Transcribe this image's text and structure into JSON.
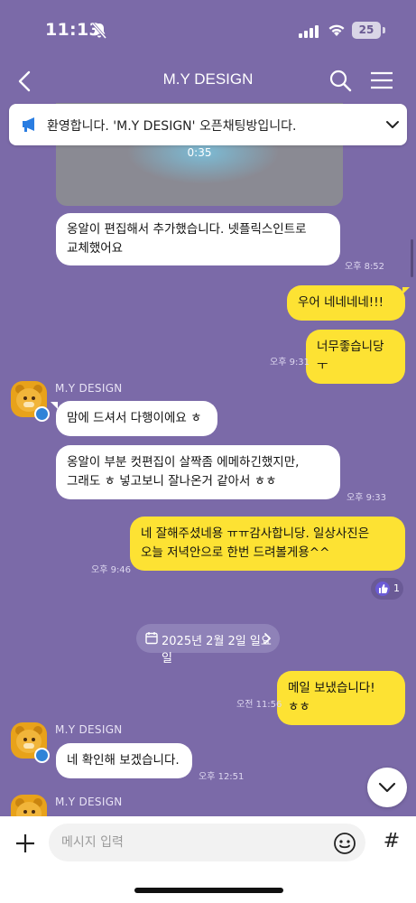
{
  "status_bar": {
    "time": "11:13",
    "battery": "25"
  },
  "header": {
    "title": "M.Y DESIGN"
  },
  "notice": {
    "text": "환영합니다. 'M.Y DESIGN' 오픈채팅방입니다."
  },
  "video": {
    "duration": "0:35"
  },
  "messages": [
    {
      "text": "옹알이 편집해서 추가했습니다. 넷플릭스인트로 교체했어요",
      "time": "오후 8:52"
    },
    {
      "text": "우어 네네네네!!!",
      "time": ""
    },
    {
      "text": "너무좋습니당 ㅜ",
      "time": "오후 9:31"
    },
    {
      "sender": "M.Y  DESIGN",
      "text": "맘에 드셔서 다행이에요 ㅎ"
    },
    {
      "text": "옹알이 부분 컷편집이 살짝좀 에메하긴했지만, 그래도 ㅎ 넣고보니 잘나온거 같아서 ㅎㅎ",
      "time": "오후 9:33"
    },
    {
      "text": "네 잘해주셨네용 ㅠㅠ감사합니당. 일상사진은 오늘 저녁안으로 한번 드려볼게용^^",
      "time": "오후 9:46",
      "reaction_count": "1"
    },
    {
      "text": "메일 보냈습니다! ㅎㅎ",
      "time": "오전 11:56"
    },
    {
      "sender": "M.Y  DESIGN",
      "text": "네 확인해 보겠습니다.",
      "time": "오후 12:51"
    },
    {
      "sender": "M.Y  DESIGN"
    }
  ],
  "date_divider": "2025년 2월 2일 일요일",
  "input": {
    "placeholder": "메시지 입력"
  },
  "bottom": {
    "hash": "#"
  },
  "colors": {
    "background": "#7b6aa8",
    "my_bubble": "#fde233",
    "other_bubble": "#ffffff"
  }
}
